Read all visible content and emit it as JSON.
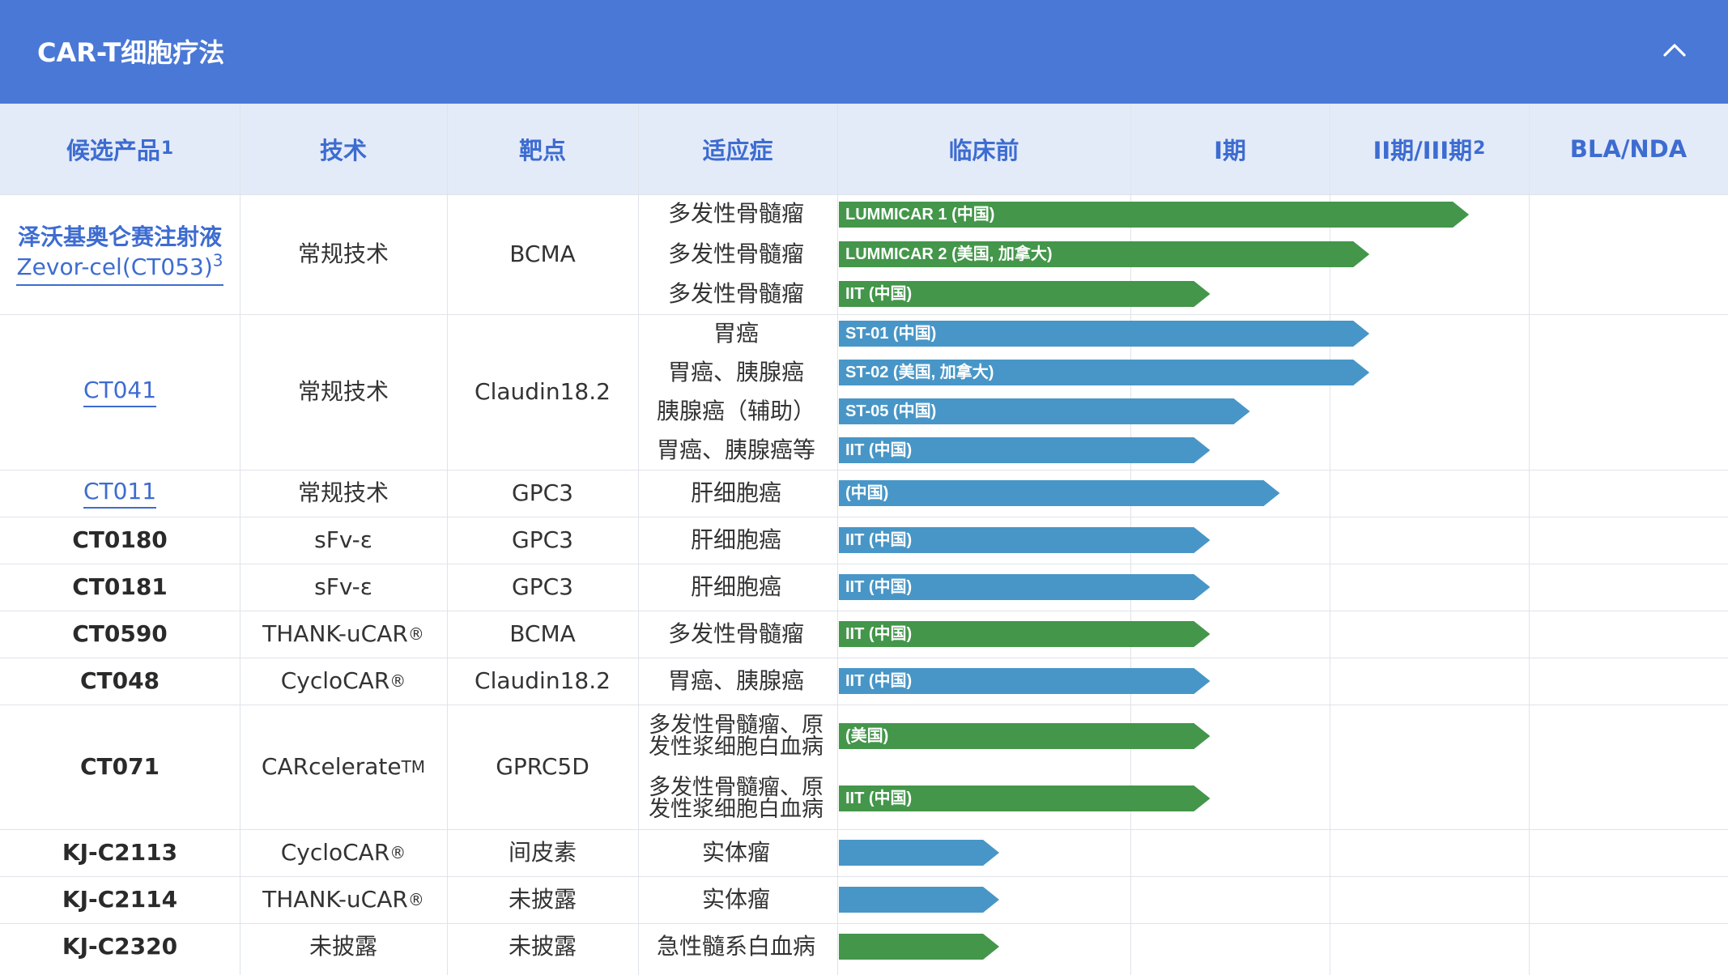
{
  "header": {
    "title": "CAR-T细胞疗法",
    "collapse_icon": "chevron-up-icon"
  },
  "columns": [
    "候选产品",
    "技术",
    "靶点",
    "适应症",
    "临床前",
    "I期",
    "II期/III期",
    "BLA/NDA"
  ],
  "column_footnotes": {
    "0": "1",
    "6": "2"
  },
  "colors": {
    "header_bg": "#4a78d6",
    "thead_bg": "#e4ebf8",
    "accent": "#3d6cd1",
    "green": "#43964a",
    "blue": "#4896c7"
  },
  "rows": [
    {
      "candidate": "泽沃基奥仑赛注射液",
      "candidate2": "Zevor-cel(CT053)",
      "footnote": "3",
      "link": true,
      "technology": "常规技术",
      "target": "BCMA",
      "indications": [
        {
          "text": "多发性骨髓瘤",
          "bar_label": "LUMMICAR 1 (中国)",
          "stage_progress": 2.7,
          "color": "green"
        },
        {
          "text": "多发性骨髓瘤",
          "bar_label": "LUMMICAR 2 (美国, 加拿大)",
          "stage_progress": 2.2,
          "color": "green"
        },
        {
          "text": "多发性骨髓瘤",
          "bar_label": "IIT (中国)",
          "stage_progress": 1.4,
          "color": "green"
        }
      ]
    },
    {
      "candidate": "CT041",
      "link": true,
      "technology": "常规技术",
      "target": "Claudin18.2",
      "indications": [
        {
          "text": "胃癌",
          "bar_label": "ST-01 (中国)",
          "stage_progress": 2.2,
          "color": "blue"
        },
        {
          "text": "胃癌、胰腺癌",
          "bar_label": "ST-02 (美国, 加拿大)",
          "stage_progress": 2.2,
          "color": "blue"
        },
        {
          "text": "胰腺癌（辅助）",
          "bar_label": "ST-05 (中国)",
          "stage_progress": 1.6,
          "color": "blue"
        },
        {
          "text": "胃癌、胰腺癌等",
          "bar_label": "IIT (中国)",
          "stage_progress": 1.4,
          "color": "blue"
        }
      ]
    },
    {
      "candidate": "CT011",
      "link": true,
      "technology": "常规技术",
      "target": "GPC3",
      "indications": [
        {
          "text": "肝细胞癌",
          "bar_label": "(中国)",
          "stage_progress": 1.75,
          "color": "blue"
        }
      ]
    },
    {
      "candidate": "CT0180",
      "technology": "sFv-ε",
      "target": "GPC3",
      "indications": [
        {
          "text": "肝细胞癌",
          "bar_label": "IIT (中国)",
          "stage_progress": 1.4,
          "color": "blue"
        }
      ]
    },
    {
      "candidate": "CT0181",
      "technology": "sFv-ε",
      "target": "GPC3",
      "indications": [
        {
          "text": "肝细胞癌",
          "bar_label": "IIT (中国)",
          "stage_progress": 1.4,
          "color": "blue"
        }
      ]
    },
    {
      "candidate": "CT0590",
      "technology": "THANK-uCAR",
      "tech_mark": "®",
      "target": "BCMA",
      "indications": [
        {
          "text": "多发性骨髓瘤",
          "bar_label": "IIT (中国)",
          "stage_progress": 1.4,
          "color": "green"
        }
      ]
    },
    {
      "candidate": "CT048",
      "technology": "CycloCAR",
      "tech_mark": "®",
      "target": "Claudin18.2",
      "indications": [
        {
          "text": "胃癌、胰腺癌",
          "bar_label": "IIT (中国)",
          "stage_progress": 1.4,
          "color": "blue"
        }
      ]
    },
    {
      "candidate": "CT071",
      "technology": "CARcelerate",
      "tech_mark": "TM",
      "target": "GPRC5D",
      "indications": [
        {
          "text": "多发性骨髓瘤、原发性浆细胞白血病",
          "bar_label": "(美国)",
          "stage_progress": 1.4,
          "color": "green"
        },
        {
          "text": "多发性骨髓瘤、原发性浆细胞白血病",
          "bar_label": "IIT (中国)",
          "stage_progress": 1.4,
          "color": "green"
        }
      ]
    },
    {
      "candidate": "KJ-C2113",
      "technology": "CycloCAR",
      "tech_mark": "®",
      "target": "间皮素",
      "indications": [
        {
          "text": "实体瘤",
          "bar_label": "",
          "stage_progress": 0.55,
          "color": "blue"
        }
      ]
    },
    {
      "candidate": "KJ-C2114",
      "technology": "THANK-uCAR",
      "tech_mark": "®",
      "target": "未披露",
      "indications": [
        {
          "text": "实体瘤",
          "bar_label": "",
          "stage_progress": 0.55,
          "color": "blue"
        }
      ]
    },
    {
      "candidate": "KJ-C2320",
      "technology": "未披露",
      "target": "未披露",
      "indications": [
        {
          "text": "急性髓系白血病",
          "bar_label": "",
          "stage_progress": 0.55,
          "color": "green"
        }
      ]
    }
  ]
}
